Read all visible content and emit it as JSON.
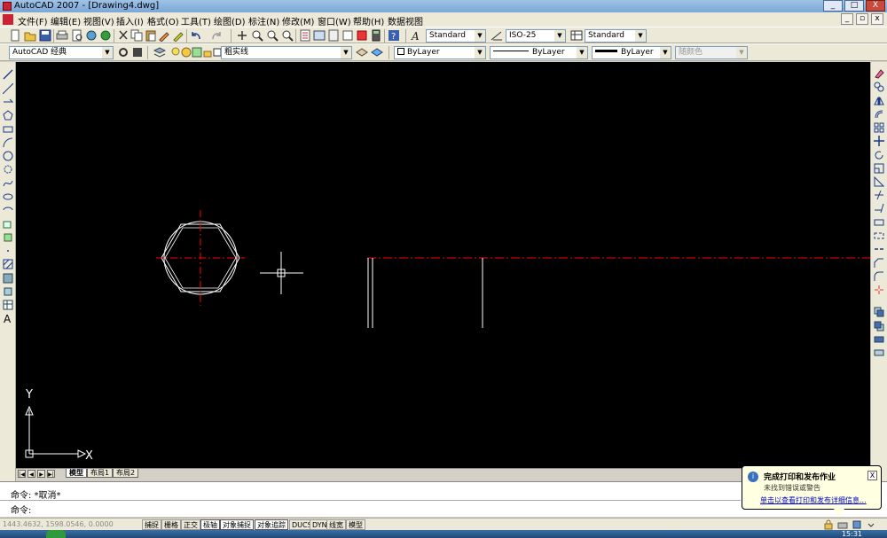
{
  "window": {
    "title": "AutoCAD 2007 - [Drawing4.dwg]",
    "buttons": [
      "_",
      "□",
      "X"
    ]
  },
  "menubar": {
    "items": [
      "文件(F)",
      "编辑(E)",
      "视图(V)",
      "插入(I)",
      "格式(O)",
      "工具(T)",
      "绘图(D)",
      "标注(N)",
      "修改(M)",
      "窗口(W)",
      "帮助(H)",
      "数据视图"
    ]
  },
  "toolbar_styles": {
    "text_style": "Standard",
    "dim_style": "ISO-25",
    "table_style": "Standard"
  },
  "toolbar_layers": {
    "workspace": "AutoCAD 经典",
    "current_layer": "粗实线",
    "color": "ByLayer",
    "linetype": "ByLayer",
    "lineweight": "ByLayer",
    "plotstyle": "随颜色"
  },
  "canvas": {
    "background": "#000000",
    "ucs_x_label": "X",
    "ucs_y_label": "Y",
    "centerline_color": "#ff0000",
    "geometry_color": "#ffffff"
  },
  "layout_tabs": {
    "nav": [
      "|◀",
      "◀",
      "▶",
      "▶|"
    ],
    "tabs": [
      "模型",
      "布局1",
      "布局2"
    ]
  },
  "command": {
    "history": "命令: *取消*",
    "prompt": "命令:"
  },
  "statusbar": {
    "coords": "1443.4632, 1598.0546, 0.0000",
    "toggles": [
      "捕捉",
      "栅格",
      "正交",
      "极轴",
      "对象捕捉",
      "对象追踪",
      "DUCS",
      "DYN",
      "线宽",
      "模型"
    ]
  },
  "notification": {
    "title": "完成打印和发布作业",
    "subtitle": "未找到错误或警告",
    "link": "单击以查看打印和发布详细信息...",
    "close": "X"
  },
  "taskbar": {
    "clock": "15:31"
  }
}
